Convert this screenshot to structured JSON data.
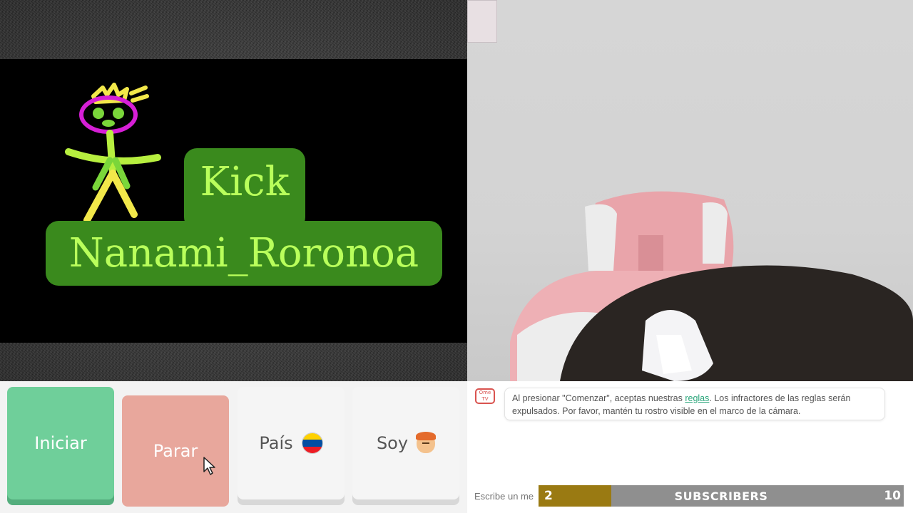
{
  "overlay": {
    "kick": "Kick",
    "username": "Nanami_Roronoa"
  },
  "buttons": {
    "start": "Iniciar",
    "stop": "Parar",
    "country": "País",
    "gender": "Soy"
  },
  "chat": {
    "logo_top": "Ome",
    "logo_bottom": "TV",
    "notice_before": "Al presionar \"Comenzar\", aceptas nuestras ",
    "notice_link": "reglas",
    "notice_after": ". Los infractores de las reglas serán expulsados. Por favor, mantén tu rostro visible en el marco de la cámara.",
    "input_placeholder": "Escribe un men"
  },
  "subscribers": {
    "current": "2",
    "label": "SUBSCRIBERS",
    "goal": "10",
    "progress": 0.2
  },
  "colors": {
    "start": "#6fcf9a",
    "stop": "#e8a79c",
    "overlay_green": "#3a8a1d",
    "overlay_text": "#b9ff5b",
    "sub_fill": "#9a7a12"
  }
}
